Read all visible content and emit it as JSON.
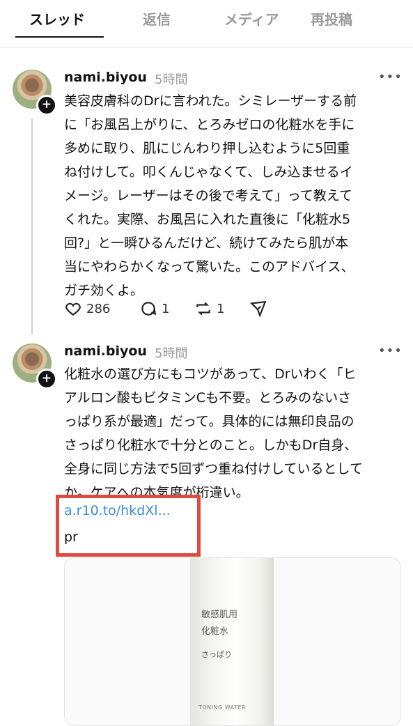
{
  "tabs": [
    {
      "label": "スレッド",
      "active": true
    },
    {
      "label": "返信",
      "active": false
    },
    {
      "label": "メディア",
      "active": false
    },
    {
      "label": "再投稿",
      "active": false
    }
  ],
  "posts": [
    {
      "username": "nami.biyou",
      "time": "5時間",
      "more": "•••",
      "text": "美容皮膚科のDrに言われた。シミレーザーする前\nに「お風呂上がりに、とろみゼロの化粧水を手に\n多めに取り、肌にじんわり押し込むように5回重\nね付けして。叩くんじゃなくて、しみ込ませるイ\nメージ。レーザーはその後で考えて」って教えて\nくれた。実際、お風呂に入れた直後に「化粧水5\n回?」と一瞬ひるんだけど、続けてみたら肌が本\n当にやわらかくなって驚いた。このアドバイス、\nガチ効くよ。",
      "likes": "286",
      "replies": "1",
      "reposts": "1"
    },
    {
      "username": "nami.biyou",
      "time": "5時間",
      "more": "•••",
      "text": "化粧水の選び方にもコツがあって、Drいわく「ヒ\nアルロン酸もビタミンCも不要。とろみのないさ\nっぱり系が最適」だって。具体的には無印良品の\nさっぱり化粧水で十分とのこと。しかもDr自身、\n全身に同じ方法で5回ずつ重ね付けしているとして\nか。ケアへの本気度が桁違い。",
      "link": "a.r10.to/hkdXl...",
      "pr": "pr",
      "product_label": {
        "line1": "敏感肌用",
        "line2": "化粧水",
        "line3": "さっぱり",
        "line4": "TONING WATER"
      }
    }
  ],
  "colors": {
    "link": "#3a8ed8",
    "highlight_box": "#e04a3f",
    "muted": "#9a9a9a"
  }
}
